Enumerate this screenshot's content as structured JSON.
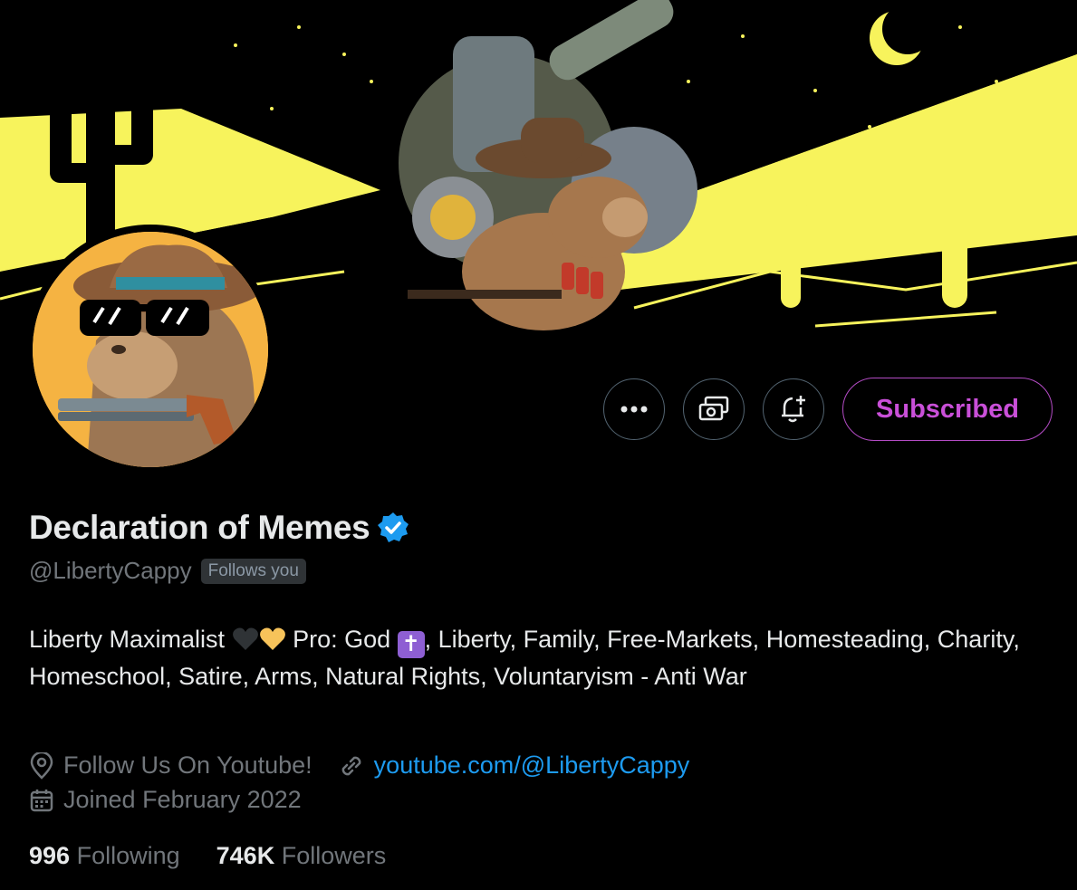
{
  "profile": {
    "display_name": "Declaration of Memes",
    "handle": "@LibertyCappy",
    "follows_you": "Follows you",
    "bio_part1": "Liberty Maximalist ",
    "bio_part2": " Pro: God ",
    "bio_emoji_cross": "✝",
    "bio_part3": ", Liberty, Family, Free-Markets, Homesteading, Charity, Homeschool, Satire, Arms, Natural Rights, Voluntaryism - Anti War",
    "location": "Follow Us On Youtube!",
    "website": "youtube.com/@LibertyCappy",
    "joined": "Joined February 2022",
    "following_count": "996",
    "following_label": "Following",
    "followers_count": "746K",
    "followers_label": "Followers"
  },
  "actions": {
    "subscribed_label": "Subscribed"
  },
  "icons": {
    "more": "more-dots-icon",
    "subscribe": "money-icon",
    "notify": "bell-plus-icon",
    "verified": "verified-badge-icon",
    "location": "location-pin-icon",
    "link": "link-icon",
    "calendar": "calendar-icon"
  },
  "colors": {
    "accent": "#1d9bf0",
    "subscribed": "#c94fd8",
    "banner_yellow": "#f7f35c"
  }
}
